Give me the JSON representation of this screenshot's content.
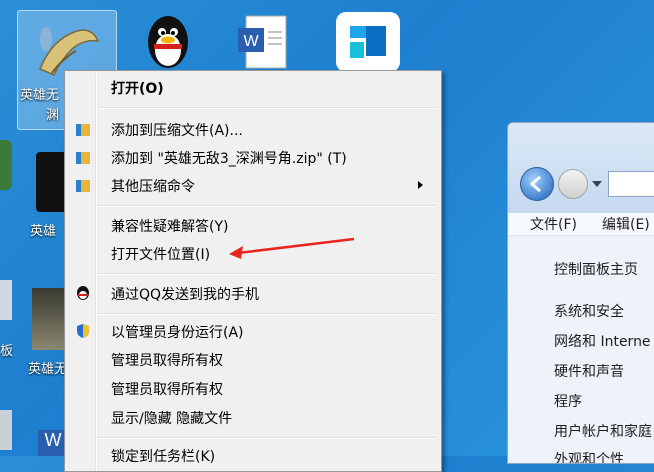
{
  "desktop": {
    "icons": [
      {
        "label_line1": "英雄无",
        "label_line2": "渊"
      },
      {
        "label": "英雄"
      },
      {
        "label": "英雄无"
      }
    ],
    "side_label": "板"
  },
  "context_menu": {
    "items": [
      {
        "label": "打开(O)",
        "bold": true
      },
      {
        "label": "添加到压缩文件(A)..."
      },
      {
        "label": "添加到 \"英雄无敌3_深渊号角.zip\" (T)"
      },
      {
        "label": "其他压缩命令"
      },
      {
        "label": "兼容性疑难解答(Y)"
      },
      {
        "label": "打开文件位置(I)"
      },
      {
        "label": "通过QQ发送到我的手机"
      },
      {
        "label": "以管理员身份运行(A)"
      },
      {
        "label": "管理员取得所有权"
      },
      {
        "label": "管理员取得所有权"
      },
      {
        "label": "显示/隐藏 隐藏文件"
      },
      {
        "label": "锁定到任务栏(K)"
      }
    ]
  },
  "explorer": {
    "menu": {
      "file": "文件(F)",
      "edit": "编辑(E)"
    },
    "nav": [
      "控制面板主页",
      "系统和安全",
      "网络和 Interne",
      "硬件和声音",
      "程序",
      "用户帐户和家庭",
      "外观和个性"
    ]
  },
  "colors": {
    "annotation_arrow": "#e8251f",
    "menu_bg": "#f0f0f0"
  }
}
